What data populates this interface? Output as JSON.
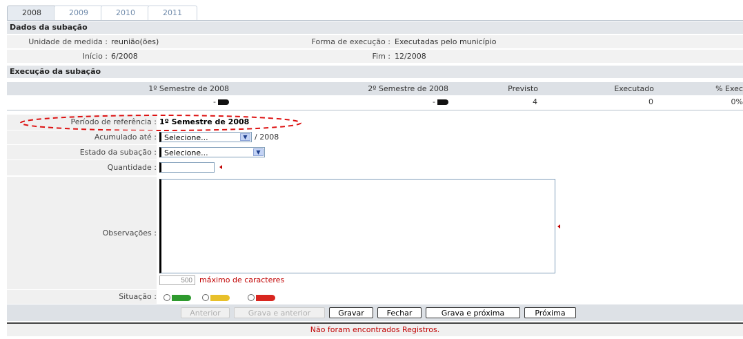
{
  "tabs": [
    "2008",
    "2009",
    "2010",
    "2011"
  ],
  "section1": {
    "title": "Dados da subação",
    "unidade_label": "Unidade de medida :",
    "unidade_value": "reunião(ões)",
    "forma_label": "Forma de execução :",
    "forma_value": "Executadas pelo município",
    "inicio_label": "Início :",
    "inicio_value": "6/2008",
    "fim_label": "Fim :",
    "fim_value": "12/2008"
  },
  "section2": {
    "title": "Execução da subação",
    "headers": [
      "1º Semestre de 2008",
      "2º Semestre de 2008",
      "Previsto",
      "Executado",
      "% Exec"
    ],
    "values": [
      "-",
      "-",
      "4",
      "0",
      "0%"
    ]
  },
  "form": {
    "periodo_label": "Período de referência :",
    "periodo_value": "1º Semestre de 2008",
    "acumulado_label": "Acumulado até :",
    "acumulado_select": "Selecione...",
    "acumulado_suffix": "/ 2008",
    "estado_label": "Estado da subação :",
    "estado_select": "Selecione...",
    "quantidade_label": "Quantidade :",
    "quantidade_value": "",
    "observacoes_label": "Observações :",
    "observacoes_value": "",
    "char_count": "500",
    "char_hint": "máximo de caracteres",
    "situacao_label": "Situação :",
    "situacao_colors": [
      "#2e9a2e",
      "#e8c02a",
      "#d8261f"
    ]
  },
  "buttons": {
    "anterior": "Anterior",
    "grava_anterior": "Grava e anterior",
    "gravar": "Gravar",
    "fechar": "Fechar",
    "grava_proxima": "Grava e próxima",
    "proxima": "Próxima"
  },
  "footer": "Não foram encontrados Registros."
}
